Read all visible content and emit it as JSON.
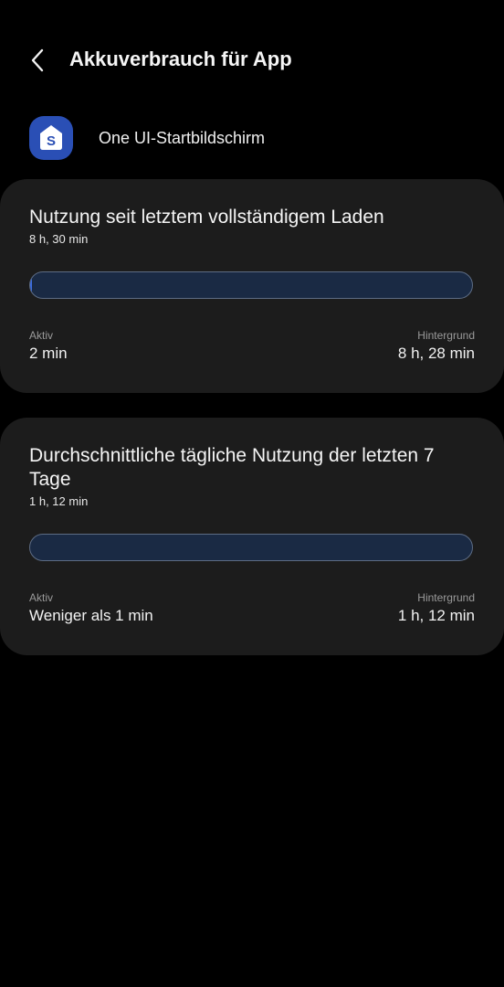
{
  "header": {
    "title": "Akkuverbrauch für App",
    "back_icon": "chevron-left-icon"
  },
  "app": {
    "name": "One UI-Startbildschirm",
    "icon": "one-ui-home-icon",
    "icon_letter": "S",
    "icon_color": "#2a4fb5"
  },
  "cards": [
    {
      "title": "Nutzung seit letztem vollständigem Laden",
      "total": "8 h, 30 min",
      "active_label": "Aktiv",
      "active_value": "2 min",
      "background_label": "Hintergrund",
      "background_value": "8 h, 28 min",
      "active_fraction": 0.004
    },
    {
      "title": "Durchschnittliche tägliche Nutzung der letzten 7 Tage",
      "total": "1 h, 12 min",
      "active_label": "Aktiv",
      "active_value": "Weniger als 1 min",
      "background_label": "Hintergrund",
      "background_value": "1 h, 12 min",
      "active_fraction": 0.0
    }
  ],
  "colors": {
    "background": "#000000",
    "card": "#1c1c1c",
    "bar_background": "#1a2a44",
    "bar_border": "#5d6c84",
    "bar_active": "#3d6de0",
    "label": "#9a9a9a"
  }
}
